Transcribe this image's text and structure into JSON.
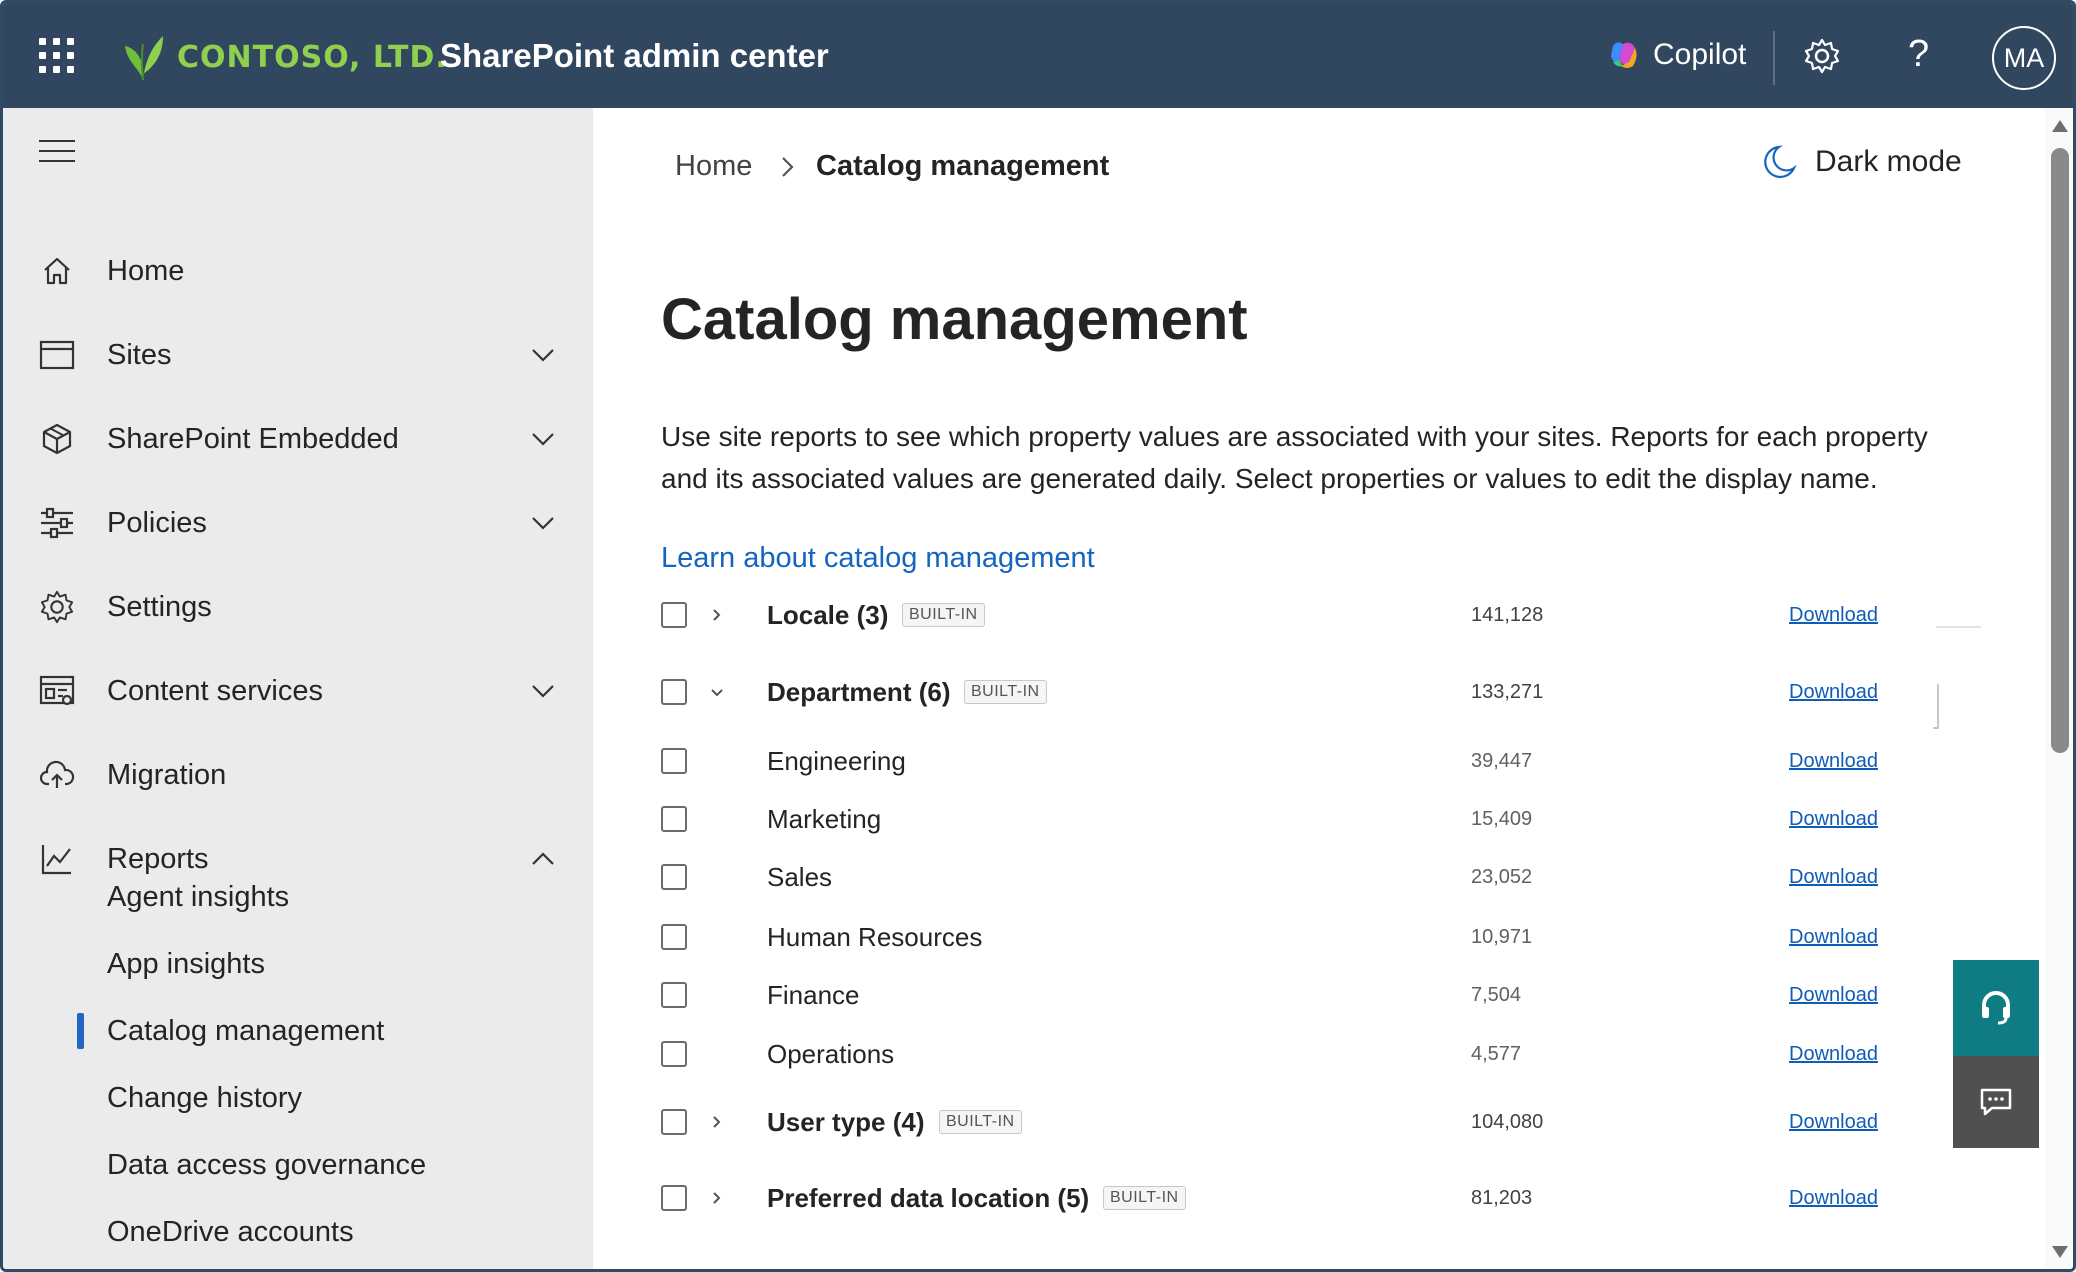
{
  "header": {
    "org_name": "CONTOSO, LTD.",
    "app_title": "SharePoint admin center",
    "copilot_label": "Copilot",
    "avatar_initials": "MA",
    "help_glyph": "?",
    "icons": [
      "waffle-icon",
      "contoso-leaf-logo",
      "copilot-icon",
      "gear-icon",
      "help-icon"
    ],
    "brand_color": "#31465f",
    "logo_color": "#8fd14f"
  },
  "sidebar": {
    "items": [
      {
        "label": "Home",
        "icon": "home-icon"
      },
      {
        "label": "Sites",
        "icon": "sites-icon",
        "expandable": true
      },
      {
        "label": "SharePoint Embedded",
        "icon": "cube-icon",
        "expandable": true
      },
      {
        "label": "Policies",
        "icon": "policies-icon",
        "expandable": true
      },
      {
        "label": "Settings",
        "icon": "gear-icon"
      },
      {
        "label": "Content services",
        "icon": "content-services-icon",
        "expandable": true
      },
      {
        "label": "Migration",
        "icon": "cloud-upload-icon"
      },
      {
        "label": "Reports",
        "icon": "chart-icon",
        "expanded": true
      }
    ],
    "reports_children": [
      "Agent insights",
      "App insights",
      "Catalog management",
      "Change history",
      "Data access governance",
      "OneDrive accounts"
    ],
    "active_child": "Catalog management"
  },
  "main": {
    "breadcrumb_home": "Home",
    "breadcrumb_current": "Catalog management",
    "dark_mode_label": "Dark mode",
    "title": "Catalog management",
    "description": "Use site reports to see which property values are associated with your sites. Reports for each property and its associated values are generated daily. Select properties or values to edit the display name.",
    "learn_link": "Learn about catalog management",
    "badge_text": "BUILT-IN",
    "download_label": "Download",
    "rows": [
      {
        "name": "Locale (3)",
        "count": "141,128",
        "parent": true,
        "expanded": false,
        "built_in": true
      },
      {
        "name": "Department (6)",
        "count": "133,271",
        "parent": true,
        "expanded": true,
        "built_in": true
      },
      {
        "name": "Engineering",
        "count": "39,447",
        "parent": false
      },
      {
        "name": "Marketing",
        "count": "15,409",
        "parent": false
      },
      {
        "name": "Sales",
        "count": "23,052",
        "parent": false
      },
      {
        "name": "Human Resources",
        "count": "10,971",
        "parent": false
      },
      {
        "name": "Finance",
        "count": "7,504",
        "parent": false
      },
      {
        "name": "Operations",
        "count": "4,577",
        "parent": false
      },
      {
        "name": "User type (4)",
        "count": "104,080",
        "parent": true,
        "expanded": false,
        "built_in": true
      },
      {
        "name": "Preferred data location (5)",
        "count": "81,203",
        "parent": true,
        "expanded": false,
        "built_in": true
      }
    ],
    "link_color": "#0f5cb8",
    "accent_color": "#2266c2"
  },
  "floating": {
    "help_button_icon": "headset-icon",
    "help_button_color": "#0f7c84",
    "feedback_button_icon": "feedback-icon",
    "feedback_button_color": "#505050"
  }
}
